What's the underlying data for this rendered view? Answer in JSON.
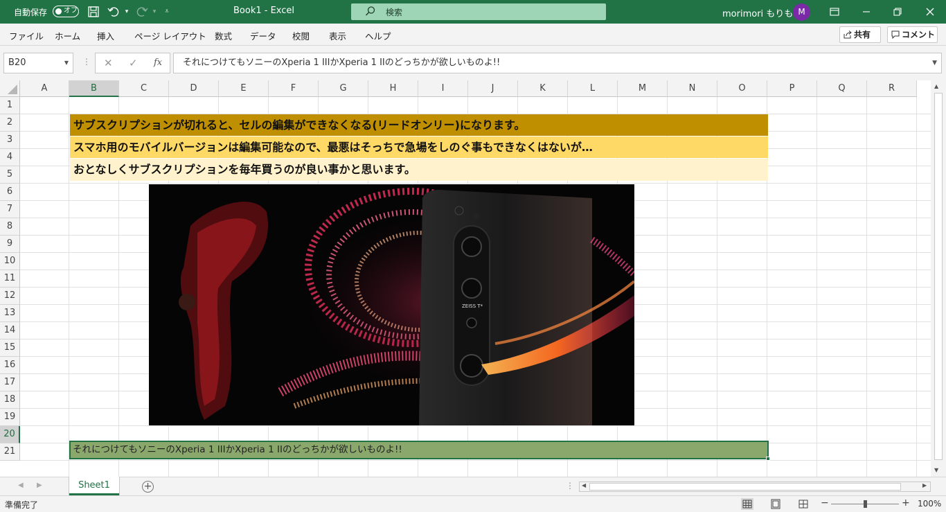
{
  "titlebar": {
    "autosave_label": "自動保存",
    "autosave_state": "オフ",
    "document_title": "Book1  -  Excel",
    "search_placeholder": "検索",
    "user_name": "morimori もりもり",
    "avatar_initial": "M"
  },
  "menu": {
    "items": [
      "ファイル",
      "ホーム",
      "挿入",
      "ページ レイアウト",
      "数式",
      "データ",
      "校閲",
      "表示",
      "ヘルプ"
    ],
    "share_label": "共有",
    "comment_label": "コメント"
  },
  "formula_bar": {
    "name_box": "B20",
    "fx_label": "fx",
    "cancel_symbol": "✕",
    "enter_symbol": "✓",
    "content": "それにつけてもソニーのXperia 1 IIIかXperia 1 IIのどっちかが欲しいものよ!!"
  },
  "grid": {
    "columns": [
      "A",
      "B",
      "C",
      "D",
      "E",
      "F",
      "G",
      "H",
      "I",
      "J",
      "K",
      "L",
      "M",
      "N",
      "O",
      "P",
      "Q",
      "R"
    ],
    "selected_column": "B",
    "rows": [
      "1",
      "2",
      "3",
      "4",
      "5",
      "6",
      "7",
      "8",
      "9",
      "10",
      "11",
      "12",
      "13",
      "14",
      "15",
      "16",
      "17",
      "18",
      "19",
      "20",
      "21"
    ],
    "selected_row": "20",
    "cells": {
      "B2": "サブスクリプションが切れると、セルの編集ができなくなる(リードオンリー)になります。",
      "B3": "スマホ用のモバイルバージョンは編集可能なので、最悪はそっちで急場をしのぐ事もできなくはないが…",
      "B4": "おとなしくサブスクリプションを毎年買うのが良い事かと思います。",
      "B20": "それにつけてもソニーのXperia 1 IIIかXperia 1 IIのどっちかが欲しいものよ!!"
    },
    "band_colors": {
      "row2": "#bf8f00",
      "row3": "#ffd966",
      "row4": "#fff2cc",
      "row20": "#8aa86c"
    },
    "photo_text": "ZEISS T*"
  },
  "sheet_tabs": {
    "tabs": [
      "Sheet1"
    ],
    "active": "Sheet1",
    "add_symbol": "+"
  },
  "status": {
    "ready_text": "準備完了",
    "zoom_level": "100%",
    "zoom_percent": 100
  },
  "colors": {
    "accent": "#217346",
    "avatar": "#7a2aa6"
  }
}
